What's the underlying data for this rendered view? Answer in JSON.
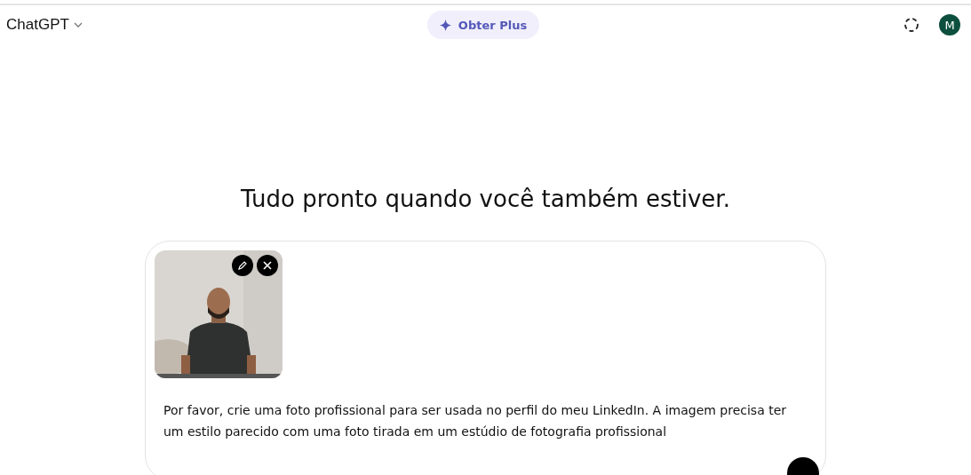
{
  "header": {
    "model": "ChatGPT",
    "upgrade": "Obter Plus",
    "avatar": "M"
  },
  "heading": "Tudo pronto quando você também estiver.",
  "composer": {
    "text": "Por favor, crie uma foto profissional para ser usada no perfil do meu LinkedIn. A imagem precisa ter um estilo parecido com uma foto tirada em um estúdio de fotografia profissional"
  }
}
